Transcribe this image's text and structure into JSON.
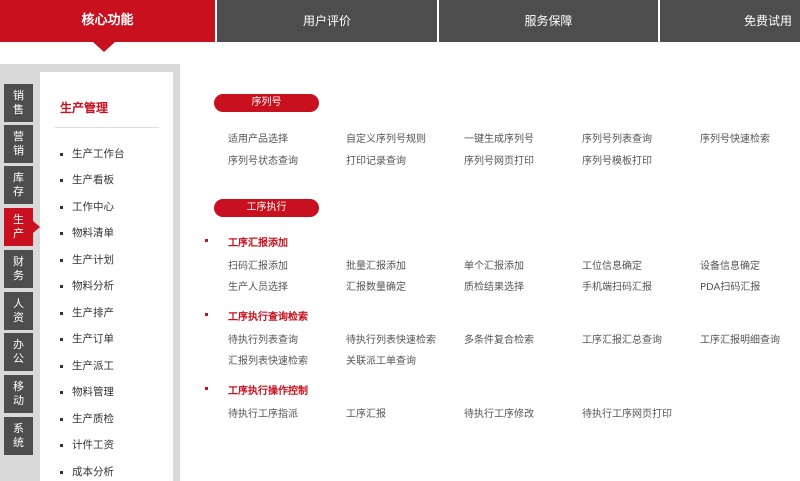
{
  "top_tabs": [
    "核心功能",
    "用户评价",
    "服务保障",
    "免费试用"
  ],
  "side_tabs": [
    {
      "line1": "销",
      "line2": "售"
    },
    {
      "line1": "营",
      "line2": "销"
    },
    {
      "line1": "库",
      "line2": "存"
    },
    {
      "line1": "生",
      "line2": "产"
    },
    {
      "line1": "财",
      "line2": "务"
    },
    {
      "line1": "人",
      "line2": "资"
    },
    {
      "line1": "办",
      "line2": "公"
    },
    {
      "line1": "移",
      "line2": "动"
    },
    {
      "line1": "系",
      "line2": "统"
    }
  ],
  "sidebar": {
    "title": "生产管理",
    "items": [
      "生产工作台",
      "生产看板",
      "工作中心",
      "物料清单",
      "生产计划",
      "物料分析",
      "生产排产",
      "生产订单",
      "生产派工",
      "物料管理",
      "生产质检",
      "计件工资",
      "成本分析"
    ]
  },
  "sections": {
    "serial": {
      "title": "序列号",
      "row1": [
        "适用产品选择",
        "自定义序列号规则",
        "一键生成序列号",
        "序列号列表查询",
        "序列号快速检索"
      ],
      "row2": [
        "序列号状态查询",
        "打印记录查询",
        "序列号网页打印",
        "序列号模板打印"
      ]
    },
    "process": {
      "title": "工序执行",
      "groups": [
        {
          "heading": "工序汇报添加",
          "row1": [
            "扫码汇报添加",
            "批量汇报添加",
            "单个汇报添加",
            "工位信息确定",
            "设备信息确定"
          ],
          "row2": [
            "生产人员选择",
            "汇报数量确定",
            "质检结果选择",
            "手机端扫码汇报",
            "PDA扫码汇报"
          ]
        },
        {
          "heading": "工序执行查询检索",
          "row1": [
            "待执行列表查询",
            "待执行列表快速检索",
            "多条件复合检索",
            "工序汇报汇总查询",
            "工序汇报明细查询"
          ],
          "row2": [
            "汇报列表快速检索",
            "关联派工单查询"
          ]
        },
        {
          "heading": "工序执行操作控制",
          "row1": [
            "待执行工序指派",
            "工序汇报",
            "待执行工序修改",
            "待执行工序网页打印"
          ]
        }
      ]
    }
  },
  "colors": {
    "accent": "#c8101e",
    "dark": "#4d4d4d",
    "panel": "#d9d9d9"
  }
}
